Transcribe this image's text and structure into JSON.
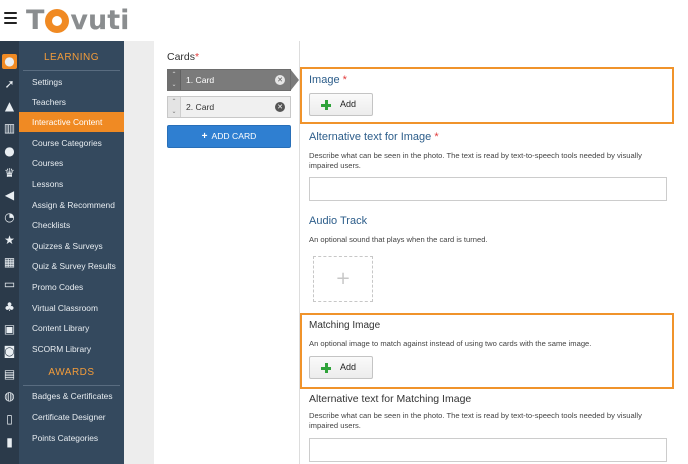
{
  "logo": {
    "text_start": "T",
    "text_end": "vuti"
  },
  "colors": {
    "accent": "#f08a23",
    "sidebar": "#34495e",
    "field_title": "#2c5d8a",
    "add_card_button": "#2f7fd1",
    "highlight": "#f0932b"
  },
  "icon_strip": {
    "icons": [
      "logo-badge-icon",
      "rocket-icon",
      "graduation-cap-icon",
      "bar-chart-icon",
      "users-icon",
      "trophy-icon",
      "megaphone-icon",
      "rss-icon",
      "star-icon",
      "table-icon",
      "credit-card-icon",
      "sitemap-icon",
      "contacts-icon",
      "cart-icon",
      "calendar-icon",
      "comments-icon",
      "file-icon",
      "address-book-icon"
    ]
  },
  "nav": {
    "learning_header": "LEARNING",
    "learning_items": [
      "Settings",
      "Teachers",
      "Interactive Content",
      "Course Categories",
      "Courses",
      "Lessons",
      "Assign & Recommend",
      "Checklists",
      "Quizzes & Surveys",
      "Quiz & Survey Results",
      "Promo Codes",
      "Virtual Classroom",
      "Content Library",
      "SCORM Library"
    ],
    "active_item": "Interactive Content",
    "awards_header": "AWARDS",
    "awards_items": [
      "Badges & Certificates",
      "Certificate Designer",
      "Points Categories"
    ]
  },
  "cards": {
    "label": "Cards",
    "required_mark": "*",
    "items": [
      {
        "label": "1. Card",
        "selected": true
      },
      {
        "label": "2. Card",
        "selected": false
      }
    ],
    "add_card_label": "ADD CARD"
  },
  "form": {
    "image": {
      "title": "Image",
      "required_mark": "*",
      "add_label": "Add"
    },
    "alt_text": {
      "title": "Alternative text for Image",
      "required_mark": "*",
      "description": "Describe what can be seen in the photo. The text is read by text-to-speech tools needed by visually impaired users.",
      "value": ""
    },
    "audio": {
      "title": "Audio Track",
      "description": "An optional sound that plays when the card is turned.",
      "placeholder_symbol": "+"
    },
    "matching_image": {
      "title": "Matching Image",
      "description": "An optional image to match against instead of using two cards with the same image.",
      "add_label": "Add"
    },
    "matching_alt_text": {
      "title": "Alternative text for Matching Image",
      "description": "Describe what can be seen in the photo. The text is read by text-to-speech tools needed by visually impaired users.",
      "value": ""
    }
  }
}
